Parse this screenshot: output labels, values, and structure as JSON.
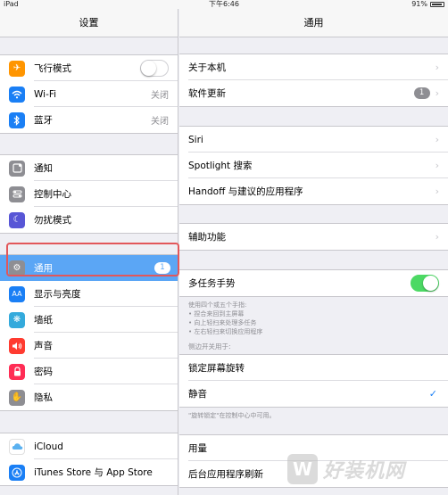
{
  "status_bar": {
    "device": "iPad",
    "time": "下午6:46",
    "battery": "91%"
  },
  "sidebar": {
    "title": "设置",
    "groups": [
      [
        {
          "label": "飞行模式",
          "icon": "airplane-icon",
          "color": "#ff9500",
          "toggle": false
        },
        {
          "label": "Wi-Fi",
          "icon": "wifi-icon",
          "color": "#1a7ff5",
          "value": "关闭"
        },
        {
          "label": "蓝牙",
          "icon": "bluetooth-icon",
          "color": "#1a7ff5",
          "value": "关闭"
        }
      ],
      [
        {
          "label": "通知",
          "icon": "notification-icon",
          "color": "#8e8e93"
        },
        {
          "label": "控制中心",
          "icon": "control-center-icon",
          "color": "#8e8e93"
        },
        {
          "label": "勿扰模式",
          "icon": "moon-icon",
          "color": "#5856d6"
        }
      ],
      [
        {
          "label": "通用",
          "icon": "gear-icon",
          "color": "#8e8e93",
          "badge": "1",
          "selected": true
        },
        {
          "label": "显示与亮度",
          "icon": "display-brightness-icon",
          "color": "#1a7ff5",
          "glyph": "AA"
        },
        {
          "label": "墙纸",
          "icon": "wallpaper-icon",
          "color": "#34aadc"
        },
        {
          "label": "声音",
          "icon": "sound-icon",
          "color": "#ff3b30"
        },
        {
          "label": "密码",
          "icon": "lock-icon",
          "color": "#ff2d55"
        },
        {
          "label": "隐私",
          "icon": "hand-icon",
          "color": "#8e8e93"
        }
      ],
      [
        {
          "label": "iCloud",
          "icon": "icloud-icon",
          "color": "#ffffff"
        },
        {
          "label": "iTunes Store 与 App Store",
          "icon": "app-store-icon",
          "color": "#1a7ff5"
        }
      ]
    ]
  },
  "main": {
    "title": "通用",
    "group1": [
      {
        "label": "关于本机"
      },
      {
        "label": "软件更新",
        "badge": "1"
      }
    ],
    "group2": [
      {
        "label": "Siri"
      },
      {
        "label": "Spotlight 搜索"
      },
      {
        "label": "Handoff 与建议的应用程序"
      }
    ],
    "group3": [
      {
        "label": "辅助功能"
      }
    ],
    "multitask": {
      "label": "多任务手势",
      "toggle": true,
      "notes": [
        "使用四个或五个手指:",
        "• 捏合来回到主屏幕",
        "• 向上轻扫来处理多任务",
        "• 左右轻扫来切换应用程序"
      ]
    },
    "side_switch_header": "侧边开关用于:",
    "side_switch": [
      {
        "label": "锁定屏幕旋转"
      },
      {
        "label": "静音",
        "checked": true
      }
    ],
    "side_switch_footer": "\"旋转锁定\"在控制中心中可用。",
    "group5": [
      {
        "label": "用量"
      },
      {
        "label": "后台应用程序刷新"
      }
    ]
  },
  "watermark": {
    "text": "好装机网"
  },
  "colors": {
    "accent": "#1a7ff5",
    "selected": "#5ba6f5",
    "toggle_on": "#4cd964",
    "highlight": "#e2575a"
  }
}
